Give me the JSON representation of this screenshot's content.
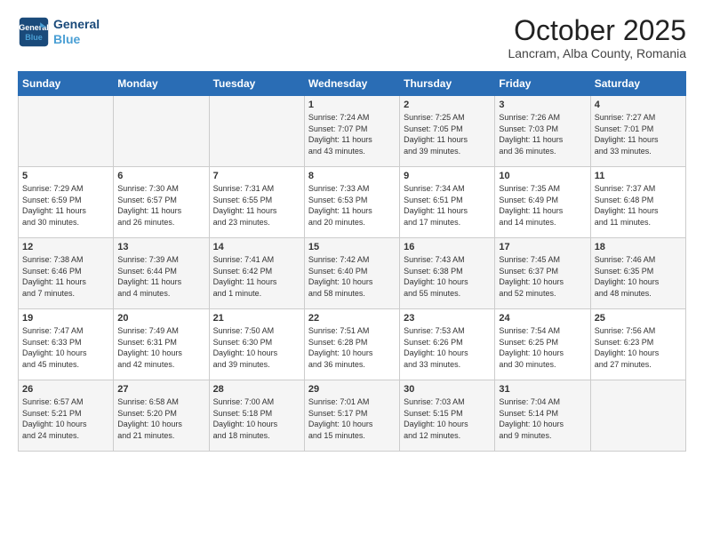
{
  "header": {
    "logo_line1": "General",
    "logo_line2": "Blue",
    "title": "October 2025",
    "subtitle": "Lancram, Alba County, Romania"
  },
  "days_of_week": [
    "Sunday",
    "Monday",
    "Tuesday",
    "Wednesday",
    "Thursday",
    "Friday",
    "Saturday"
  ],
  "weeks": [
    [
      {
        "day": "",
        "info": ""
      },
      {
        "day": "",
        "info": ""
      },
      {
        "day": "",
        "info": ""
      },
      {
        "day": "1",
        "info": "Sunrise: 7:24 AM\nSunset: 7:07 PM\nDaylight: 11 hours\nand 43 minutes."
      },
      {
        "day": "2",
        "info": "Sunrise: 7:25 AM\nSunset: 7:05 PM\nDaylight: 11 hours\nand 39 minutes."
      },
      {
        "day": "3",
        "info": "Sunrise: 7:26 AM\nSunset: 7:03 PM\nDaylight: 11 hours\nand 36 minutes."
      },
      {
        "day": "4",
        "info": "Sunrise: 7:27 AM\nSunset: 7:01 PM\nDaylight: 11 hours\nand 33 minutes."
      }
    ],
    [
      {
        "day": "5",
        "info": "Sunrise: 7:29 AM\nSunset: 6:59 PM\nDaylight: 11 hours\nand 30 minutes."
      },
      {
        "day": "6",
        "info": "Sunrise: 7:30 AM\nSunset: 6:57 PM\nDaylight: 11 hours\nand 26 minutes."
      },
      {
        "day": "7",
        "info": "Sunrise: 7:31 AM\nSunset: 6:55 PM\nDaylight: 11 hours\nand 23 minutes."
      },
      {
        "day": "8",
        "info": "Sunrise: 7:33 AM\nSunset: 6:53 PM\nDaylight: 11 hours\nand 20 minutes."
      },
      {
        "day": "9",
        "info": "Sunrise: 7:34 AM\nSunset: 6:51 PM\nDaylight: 11 hours\nand 17 minutes."
      },
      {
        "day": "10",
        "info": "Sunrise: 7:35 AM\nSunset: 6:49 PM\nDaylight: 11 hours\nand 14 minutes."
      },
      {
        "day": "11",
        "info": "Sunrise: 7:37 AM\nSunset: 6:48 PM\nDaylight: 11 hours\nand 11 minutes."
      }
    ],
    [
      {
        "day": "12",
        "info": "Sunrise: 7:38 AM\nSunset: 6:46 PM\nDaylight: 11 hours\nand 7 minutes."
      },
      {
        "day": "13",
        "info": "Sunrise: 7:39 AM\nSunset: 6:44 PM\nDaylight: 11 hours\nand 4 minutes."
      },
      {
        "day": "14",
        "info": "Sunrise: 7:41 AM\nSunset: 6:42 PM\nDaylight: 11 hours\nand 1 minute."
      },
      {
        "day": "15",
        "info": "Sunrise: 7:42 AM\nSunset: 6:40 PM\nDaylight: 10 hours\nand 58 minutes."
      },
      {
        "day": "16",
        "info": "Sunrise: 7:43 AM\nSunset: 6:38 PM\nDaylight: 10 hours\nand 55 minutes."
      },
      {
        "day": "17",
        "info": "Sunrise: 7:45 AM\nSunset: 6:37 PM\nDaylight: 10 hours\nand 52 minutes."
      },
      {
        "day": "18",
        "info": "Sunrise: 7:46 AM\nSunset: 6:35 PM\nDaylight: 10 hours\nand 48 minutes."
      }
    ],
    [
      {
        "day": "19",
        "info": "Sunrise: 7:47 AM\nSunset: 6:33 PM\nDaylight: 10 hours\nand 45 minutes."
      },
      {
        "day": "20",
        "info": "Sunrise: 7:49 AM\nSunset: 6:31 PM\nDaylight: 10 hours\nand 42 minutes."
      },
      {
        "day": "21",
        "info": "Sunrise: 7:50 AM\nSunset: 6:30 PM\nDaylight: 10 hours\nand 39 minutes."
      },
      {
        "day": "22",
        "info": "Sunrise: 7:51 AM\nSunset: 6:28 PM\nDaylight: 10 hours\nand 36 minutes."
      },
      {
        "day": "23",
        "info": "Sunrise: 7:53 AM\nSunset: 6:26 PM\nDaylight: 10 hours\nand 33 minutes."
      },
      {
        "day": "24",
        "info": "Sunrise: 7:54 AM\nSunset: 6:25 PM\nDaylight: 10 hours\nand 30 minutes."
      },
      {
        "day": "25",
        "info": "Sunrise: 7:56 AM\nSunset: 6:23 PM\nDaylight: 10 hours\nand 27 minutes."
      }
    ],
    [
      {
        "day": "26",
        "info": "Sunrise: 6:57 AM\nSunset: 5:21 PM\nDaylight: 10 hours\nand 24 minutes."
      },
      {
        "day": "27",
        "info": "Sunrise: 6:58 AM\nSunset: 5:20 PM\nDaylight: 10 hours\nand 21 minutes."
      },
      {
        "day": "28",
        "info": "Sunrise: 7:00 AM\nSunset: 5:18 PM\nDaylight: 10 hours\nand 18 minutes."
      },
      {
        "day": "29",
        "info": "Sunrise: 7:01 AM\nSunset: 5:17 PM\nDaylight: 10 hours\nand 15 minutes."
      },
      {
        "day": "30",
        "info": "Sunrise: 7:03 AM\nSunset: 5:15 PM\nDaylight: 10 hours\nand 12 minutes."
      },
      {
        "day": "31",
        "info": "Sunrise: 7:04 AM\nSunset: 5:14 PM\nDaylight: 10 hours\nand 9 minutes."
      },
      {
        "day": "",
        "info": ""
      }
    ]
  ]
}
